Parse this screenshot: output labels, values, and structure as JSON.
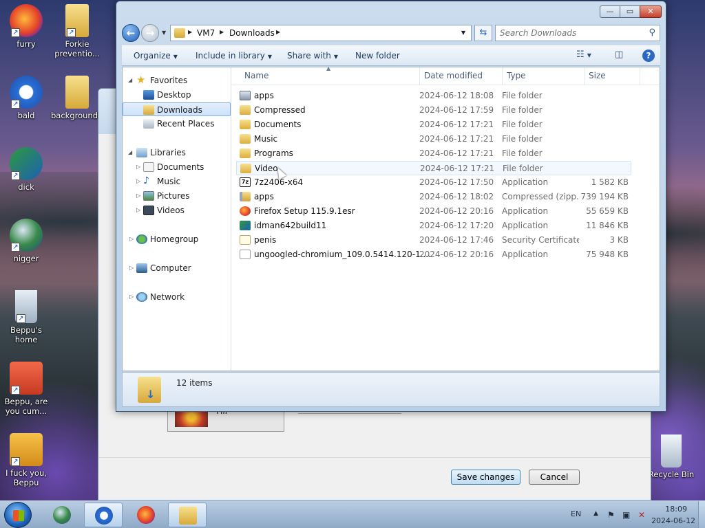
{
  "desktop": {
    "icons": [
      {
        "label": "furry"
      },
      {
        "label": "Forkie preventio..."
      },
      {
        "label": "bald"
      },
      {
        "label": "background..."
      },
      {
        "label": "dick"
      },
      {
        "label": "nigger"
      },
      {
        "label": "Beppu's home"
      },
      {
        "label": "Beppu, are you cum..."
      },
      {
        "label": "I fuck you, Beppu"
      },
      {
        "label": "Recycle Bin"
      }
    ]
  },
  "background_window": {
    "fill_label": "Fill",
    "save_label": "Save changes",
    "cancel_label": "Cancel"
  },
  "dialog": {
    "caption_min": "—",
    "caption_max": "▭",
    "caption_close": "✕",
    "breadcrumb": [
      "VM7",
      "Downloads"
    ],
    "search_placeholder": "Search Downloads",
    "toolbar": {
      "organize": "Organize",
      "include_in_library": "Include in library",
      "share_with": "Share with",
      "new_folder": "New folder"
    },
    "nav": {
      "favorites": "Favorites",
      "desktop": "Desktop",
      "downloads": "Downloads",
      "recent_places": "Recent Places",
      "libraries": "Libraries",
      "documents": "Documents",
      "music": "Music",
      "pictures": "Pictures",
      "videos": "Videos",
      "homegroup": "Homegroup",
      "computer": "Computer",
      "network": "Network"
    },
    "columns": {
      "name": "Name",
      "date": "Date modified",
      "type": "Type",
      "size": "Size"
    },
    "files": [
      {
        "name": "apps",
        "date": "2024-06-12 18:08",
        "type": "File folder",
        "size": "",
        "icon": "app-folder-icon"
      },
      {
        "name": "Compressed",
        "date": "2024-06-12 17:59",
        "type": "File folder",
        "size": "",
        "icon": "folder-icon"
      },
      {
        "name": "Documents",
        "date": "2024-06-12 17:21",
        "type": "File folder",
        "size": "",
        "icon": "folder-icon"
      },
      {
        "name": "Music",
        "date": "2024-06-12 17:21",
        "type": "File folder",
        "size": "",
        "icon": "folder-icon"
      },
      {
        "name": "Programs",
        "date": "2024-06-12 17:21",
        "type": "File folder",
        "size": "",
        "icon": "folder-icon"
      },
      {
        "name": "Video",
        "date": "2024-06-12 17:21",
        "type": "File folder",
        "size": "",
        "icon": "folder-icon"
      },
      {
        "name": "7z2406-x64",
        "date": "2024-06-12 17:50",
        "type": "Application",
        "size": "1 582 KB",
        "icon": "7zip-icon"
      },
      {
        "name": "apps",
        "date": "2024-06-12 18:02",
        "type": "Compressed (zipp...",
        "size": "739 194 KB",
        "icon": "zip-icon"
      },
      {
        "name": "Firefox Setup 115.9.1esr",
        "date": "2024-06-12 20:16",
        "type": "Application",
        "size": "55 659 KB",
        "icon": "firefox-icon"
      },
      {
        "name": "idman642build11",
        "date": "2024-06-12 17:20",
        "type": "Application",
        "size": "11 846 KB",
        "icon": "idm-icon"
      },
      {
        "name": "penis",
        "date": "2024-06-12 17:46",
        "type": "Security Certificate",
        "size": "3 KB",
        "icon": "certificate-icon"
      },
      {
        "name": "ungoogled-chromium_109.0.5414.120-1....",
        "date": "2024-06-12 20:16",
        "type": "Application",
        "size": "75 948 KB",
        "icon": "chromium-icon"
      }
    ],
    "status_count": "12 items"
  },
  "taskbar": {
    "lang": "EN",
    "time": "18:09",
    "date": "2024-06-12"
  },
  "icons_text": {
    "sevenzip": "7z"
  }
}
